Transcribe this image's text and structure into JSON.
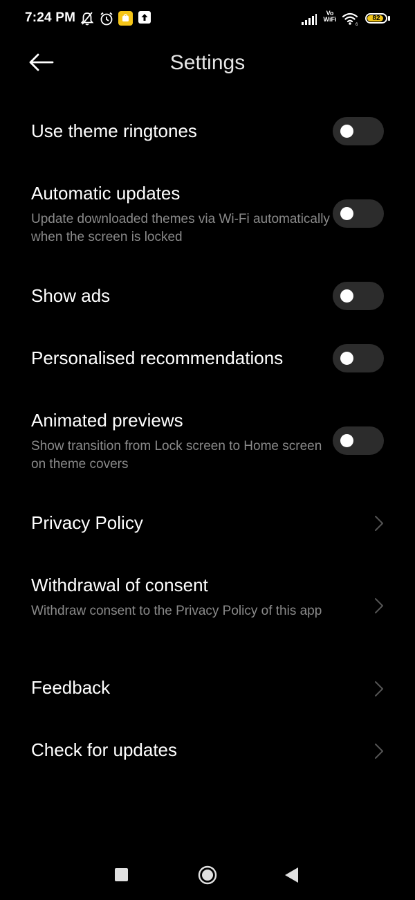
{
  "status_bar": {
    "time": "7:24 PM",
    "vowifi_top": "Vo",
    "vowifi_bottom": "WiFi",
    "battery_level": "82",
    "icons": [
      "mute-bell-icon",
      "alarm-icon",
      "notification-app-icon",
      "upload-icon",
      "signal-icon",
      "vowifi-icon",
      "wifi-icon",
      "battery-icon"
    ]
  },
  "header": {
    "title": "Settings",
    "back_icon": "back-arrow-icon"
  },
  "settings": {
    "use_theme_ringtones": {
      "title": "Use theme ringtones",
      "enabled": false
    },
    "automatic_updates": {
      "title": "Automatic updates",
      "subtitle": "Update downloaded themes via Wi-Fi automatically when the screen is locked",
      "enabled": false
    },
    "show_ads": {
      "title": "Show ads",
      "enabled": false
    },
    "personalised_recommendations": {
      "title": "Personalised recommendations",
      "enabled": false
    },
    "animated_previews": {
      "title": "Animated previews",
      "subtitle": "Show transition from Lock screen to Home screen on theme covers",
      "enabled": false
    },
    "privacy_policy": {
      "title": "Privacy Policy"
    },
    "withdrawal_of_consent": {
      "title": "Withdrawal of consent",
      "subtitle": "Withdraw consent to the Privacy Policy of this app"
    },
    "feedback": {
      "title": "Feedback"
    },
    "check_for_updates": {
      "title": "Check for updates"
    }
  },
  "nav_bar": {
    "icons": [
      "recents-square-icon",
      "home-circle-icon",
      "back-triangle-icon"
    ]
  },
  "colors": {
    "background": "#000000",
    "toggle_off_track": "#2c2c2c",
    "subtitle_text": "#8a8a8a",
    "battery_fill": "#f0c419"
  }
}
